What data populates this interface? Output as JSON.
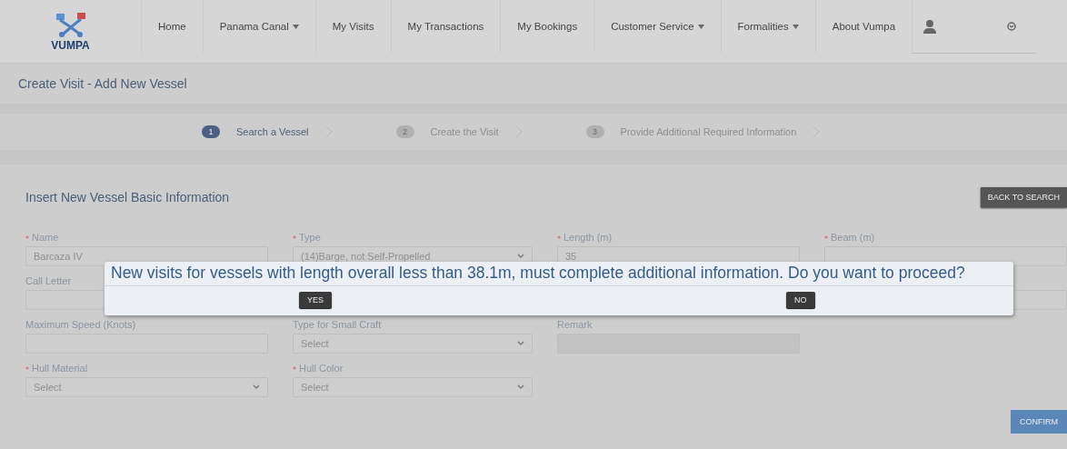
{
  "navbar": {
    "logo": "VUMPA",
    "items": [
      {
        "label": "Home"
      },
      {
        "label": "Panama Canal",
        "dropdown": true
      },
      {
        "label": "My Visits"
      },
      {
        "label": "My Transactions"
      },
      {
        "label": "My Bookings"
      },
      {
        "label": "Customer Service",
        "dropdown": true
      },
      {
        "label": "Formalities",
        "dropdown": true
      },
      {
        "label": "About Vumpa"
      }
    ]
  },
  "page_title": "Create Visit - Add New Vessel",
  "steps": [
    {
      "number": "1",
      "label": "Search a Vessel",
      "active": true
    },
    {
      "number": "2",
      "label": "Create the Visit",
      "active": false
    },
    {
      "number": "3",
      "label": "Provide Additional Required Information",
      "active": false
    }
  ],
  "section": {
    "title": "Insert New Vessel Basic Information",
    "back_button": "BACK TO SEARCH"
  },
  "form_rows": [
    [
      {
        "kind": "input",
        "label": "Name",
        "required": true,
        "value": "Barcaza IV"
      },
      {
        "kind": "select",
        "label": "Type",
        "required": true,
        "value": "(14)Barge, not Self-Propelled"
      },
      {
        "kind": "input",
        "label": "Length (m)",
        "required": true,
        "value": "35"
      },
      {
        "kind": "input",
        "label": "Beam (m)",
        "required": true
      }
    ],
    [
      {
        "kind": "input",
        "label": "Call Letter"
      },
      {
        "kind": "covered"
      },
      {
        "kind": "covered"
      },
      {
        "kind": "input"
      }
    ],
    [
      {
        "kind": "input",
        "label": "Maximum Speed (Knots)"
      },
      {
        "kind": "select",
        "label": "Type for Small Craft",
        "value": "Select"
      },
      {
        "kind": "disabled",
        "label": "Remark"
      }
    ],
    [
      {
        "kind": "select",
        "label": "Hull Material",
        "required": true,
        "value": "Select"
      },
      {
        "kind": "select",
        "label": "Hull Color",
        "required": true,
        "value": "Select"
      }
    ]
  ],
  "confirm_button": "CONFIRM",
  "dialog": {
    "message": "New visits for vessels with length overall less than 38.1m, must complete additional information. Do you want to proceed?",
    "buttons": [
      "YES",
      "NO"
    ]
  }
}
